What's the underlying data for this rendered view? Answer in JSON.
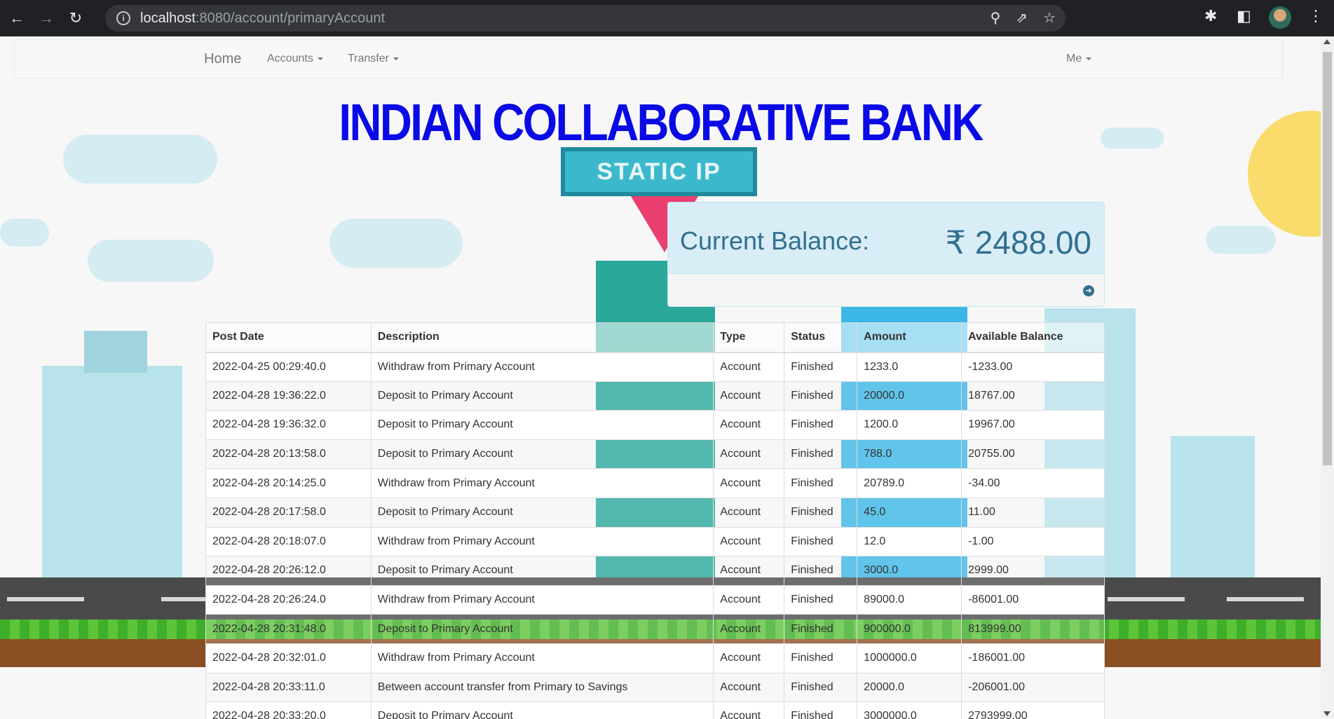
{
  "browser": {
    "url_host": "localhost",
    "url_path": ":8080/account/primaryAccount"
  },
  "navbar": {
    "brand": "Home",
    "accounts": "Accounts",
    "transfer": "Transfer",
    "me": "Me"
  },
  "bank_title": "INDIAN COLLABORATIVE BANK",
  "background": {
    "sign_text": "STATIC IP"
  },
  "balance": {
    "label": "Current Balance:",
    "amount": "₹ 2488.00"
  },
  "table": {
    "headers": [
      "Post Date",
      "Description",
      "Type",
      "Status",
      "Amount",
      "Available Balance"
    ],
    "rows": [
      [
        "2022-04-25 00:29:40.0",
        "Withdraw from Primary Account",
        "Account",
        "Finished",
        "1233.0",
        "-1233.00"
      ],
      [
        "2022-04-28 19:36:22.0",
        "Deposit to Primary Account",
        "Account",
        "Finished",
        "20000.0",
        "18767.00"
      ],
      [
        "2022-04-28 19:36:32.0",
        "Deposit to Primary Account",
        "Account",
        "Finished",
        "1200.0",
        "19967.00"
      ],
      [
        "2022-04-28 20:13:58.0",
        "Deposit to Primary Account",
        "Account",
        "Finished",
        "788.0",
        "20755.00"
      ],
      [
        "2022-04-28 20:14:25.0",
        "Withdraw from Primary Account",
        "Account",
        "Finished",
        "20789.0",
        "-34.00"
      ],
      [
        "2022-04-28 20:17:58.0",
        "Deposit to Primary Account",
        "Account",
        "Finished",
        "45.0",
        "11.00"
      ],
      [
        "2022-04-28 20:18:07.0",
        "Withdraw from Primary Account",
        "Account",
        "Finished",
        "12.0",
        "-1.00"
      ],
      [
        "2022-04-28 20:26:12.0",
        "Deposit to Primary Account",
        "Account",
        "Finished",
        "3000.0",
        "2999.00"
      ],
      [
        "2022-04-28 20:26:24.0",
        "Withdraw from Primary Account",
        "Account",
        "Finished",
        "89000.0",
        "-86001.00"
      ],
      [
        "2022-04-28 20:31:48.0",
        "Deposit to Primary Account",
        "Account",
        "Finished",
        "900000.0",
        "813999.00"
      ],
      [
        "2022-04-28 20:32:01.0",
        "Withdraw from Primary Account",
        "Account",
        "Finished",
        "1000000.0",
        "-186001.00"
      ],
      [
        "2022-04-28 20:33:11.0",
        "Between account transfer from Primary to Savings",
        "Account",
        "Finished",
        "20000.0",
        "-206001.00"
      ],
      [
        "2022-04-28 20:33:20.0",
        "Deposit to Primary Account",
        "Account",
        "Finished",
        "3000000.0",
        "2793999.00"
      ]
    ]
  }
}
